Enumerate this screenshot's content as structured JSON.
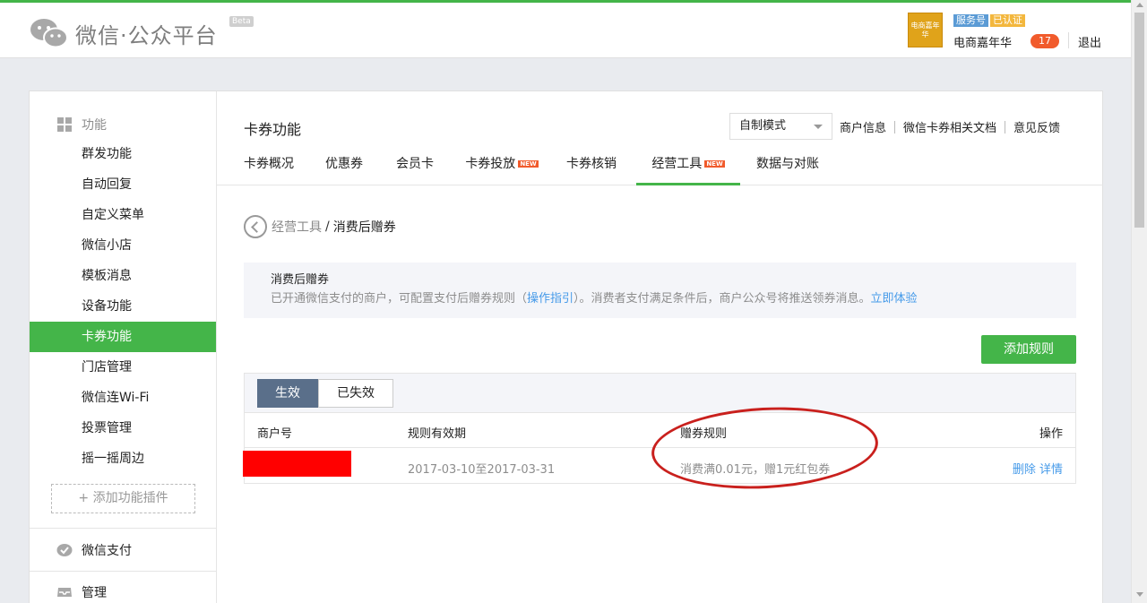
{
  "header": {
    "logo_text": "微信·公众平台",
    "beta": "Beta",
    "avatar_text": "电商嘉年华",
    "badge_service": "服务号",
    "badge_verified": "已认证",
    "account_name": "电商嘉年华",
    "message_count": "17",
    "logout": "退出"
  },
  "sidebar": {
    "group_function": "功能",
    "items": [
      "群发功能",
      "自动回复",
      "自定义菜单",
      "微信小店",
      "模板消息",
      "设备功能",
      "卡券功能",
      "门店管理",
      "微信连Wi-Fi",
      "投票管理",
      "摇一摇周边"
    ],
    "active_item": "卡券功能",
    "add_plugin": "+ 添加功能插件",
    "group_pay": "微信支付",
    "group_manage": "管理"
  },
  "main": {
    "title": "卡券功能",
    "mode_select": "自制模式",
    "toplinks": [
      "商户信息",
      "微信卡券相关文档",
      "意见反馈"
    ],
    "tabs": [
      {
        "label": "卡券概况",
        "new": ""
      },
      {
        "label": "优惠券",
        "new": ""
      },
      {
        "label": "会员卡",
        "new": ""
      },
      {
        "label": "卡券投放",
        "new": "NEW"
      },
      {
        "label": "卡券核销",
        "new": ""
      },
      {
        "label": "经营工具",
        "new": "NEW"
      },
      {
        "label": "数据与对账",
        "new": ""
      }
    ],
    "breadcrumb_parent": "经营工具",
    "breadcrumb_sep": "/",
    "breadcrumb_current": "消费后赠券",
    "info_title": "消费后赠券",
    "info_desc_1": "已开通微信支付的商户，可配置支付后赠券规则（",
    "info_link_guide": "操作指引",
    "info_desc_2": "）。消费者支付满足条件后，商户公众号将推送领券消息。",
    "info_link_try": "立即体验",
    "add_rule": "添加规则",
    "filter_active": "生效",
    "filter_expired": "已失效",
    "columns": [
      "商户号",
      "规则有效期",
      "赠券规则",
      "操作"
    ],
    "row": {
      "validity": "2017-03-10至2017-03-31",
      "rule": "消费满0.01元，赠1元红包券",
      "op_delete": "删除",
      "op_detail": "详情"
    }
  },
  "colors": {
    "brand_green": "#44b549",
    "link_blue": "#459ae9",
    "annotation_red": "#c9201d",
    "redaction_red": "#ff0000"
  }
}
